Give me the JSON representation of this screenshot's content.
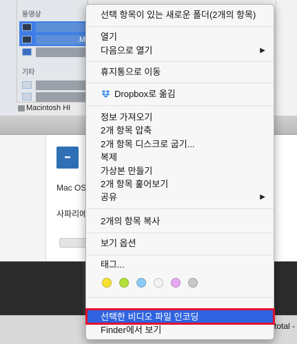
{
  "finder": {
    "sidebar": {
      "movies_label": "동영상",
      "other_label": "기타",
      "selected_file_ext": ".M"
    },
    "pathbar_label": "Macintosh HI"
  },
  "info_panel": {
    "line1": "Mac OS",
    "line2": "사파리에"
  },
  "footer": {
    "partial_text": "total -"
  },
  "context_menu": {
    "new_folder": "선택 항목이 있는 새로운 폴더(2개의 항목)",
    "open": "열기",
    "open_with": "다음으로 열기",
    "move_to_trash": "휴지통으로 이동",
    "dropbox_move": "Dropbox로 옮김",
    "get_info": "정보 가져오기",
    "compress": "2개 항목 압축",
    "burn": "2개 항목 디스크로 굽기...",
    "duplicate": "복제",
    "make_alias": "가상본 만들기",
    "quick_look": "2개 항목 훑어보기",
    "share": "공유",
    "copy_items": "2개의 항목 복사",
    "view_options": "보기 옵션",
    "tags": "태그...",
    "encode_video": "선택한 비디오 파일 인코딩",
    "show_in_finder": "Finder에서 보기",
    "submenu_arrow": "▶"
  },
  "tag_colors": [
    "#f5e12f",
    "#b4e03a",
    "#8ec8f5",
    "#f2f2f2",
    "#e6a8f0",
    "#c8c8c8"
  ],
  "colors": {
    "highlight": "#2f63e0",
    "annotation_box": "#e4102b",
    "dropbox_blue": "#3d8ee8"
  }
}
